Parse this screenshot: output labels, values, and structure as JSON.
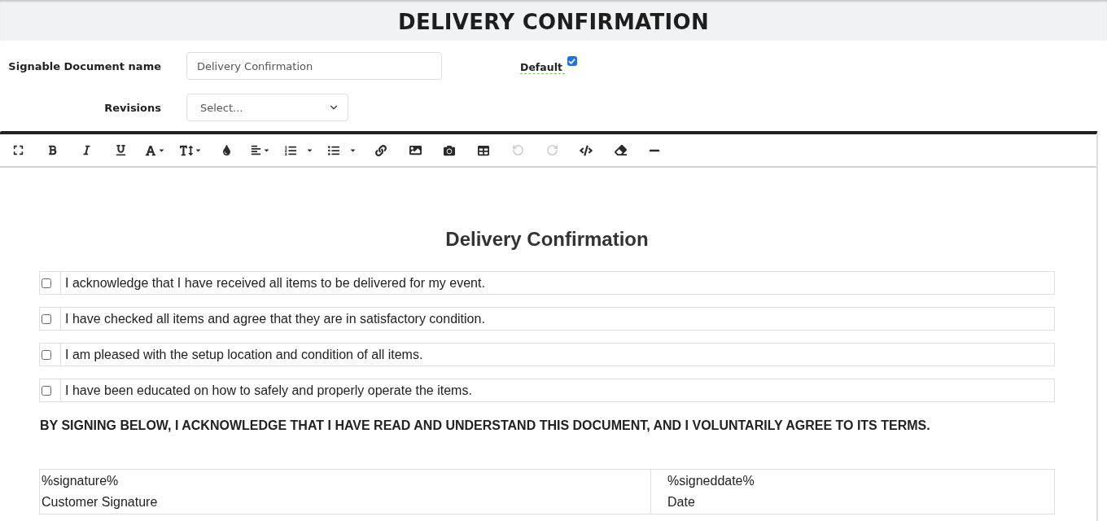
{
  "header": {
    "title": "DELIVERY CONFIRMATION"
  },
  "form": {
    "document_name": {
      "label": "Signable Document name",
      "value": "Delivery Confirmation"
    },
    "default": {
      "label": "Default",
      "checked": true
    },
    "revisions": {
      "label": "Revisions",
      "value": "Select..."
    }
  },
  "toolbar": [
    {
      "kind": "fullscreen",
      "dropdown": false,
      "disabled": false
    },
    {
      "kind": "bold",
      "dropdown": false,
      "disabled": false
    },
    {
      "kind": "italic",
      "dropdown": false,
      "disabled": false
    },
    {
      "kind": "underline",
      "dropdown": false,
      "disabled": false
    },
    {
      "kind": "font",
      "dropdown": true,
      "disabled": false
    },
    {
      "kind": "fontsize",
      "dropdown": true,
      "disabled": false
    },
    {
      "kind": "color",
      "dropdown": false,
      "disabled": false
    },
    {
      "kind": "align",
      "dropdown": true,
      "disabled": false
    },
    {
      "kind": "orderedlist",
      "dropdown": true,
      "disabled": false
    },
    {
      "kind": "bulletlist",
      "dropdown": true,
      "disabled": false
    },
    {
      "kind": "link",
      "dropdown": false,
      "disabled": false
    },
    {
      "kind": "image",
      "dropdown": false,
      "disabled": false
    },
    {
      "kind": "camera",
      "dropdown": false,
      "disabled": false
    },
    {
      "kind": "table",
      "dropdown": false,
      "disabled": false
    },
    {
      "kind": "undo",
      "dropdown": false,
      "disabled": true
    },
    {
      "kind": "redo",
      "dropdown": false,
      "disabled": true
    },
    {
      "kind": "code",
      "dropdown": false,
      "disabled": false
    },
    {
      "kind": "eraser",
      "dropdown": false,
      "disabled": false
    },
    {
      "kind": "hr",
      "dropdown": false,
      "disabled": false
    }
  ],
  "document": {
    "heading": "Delivery Confirmation",
    "checklist": [
      {
        "text": "I acknowledge that I have received all items to be delivered for my event.",
        "checked": false
      },
      {
        "text": "I have checked all items and agree that they are in satisfactory condition.",
        "checked": false
      },
      {
        "text": "I am pleased with the setup location and condition of all items.",
        "checked": false
      },
      {
        "text": "I have been educated on how to safely and properly operate the items.",
        "checked": false
      }
    ],
    "statement": "BY SIGNING BELOW, I ACKNOWLEDGE THAT I HAVE READ AND UNDERSTAND THIS DOCUMENT, AND I VOLUNTARILY AGREE TO ITS TERMS.",
    "signature_table": [
      {
        "token": "%signature%",
        "caption": "Customer Signature"
      },
      {
        "token": "%signeddate%",
        "caption": "Date"
      }
    ]
  }
}
